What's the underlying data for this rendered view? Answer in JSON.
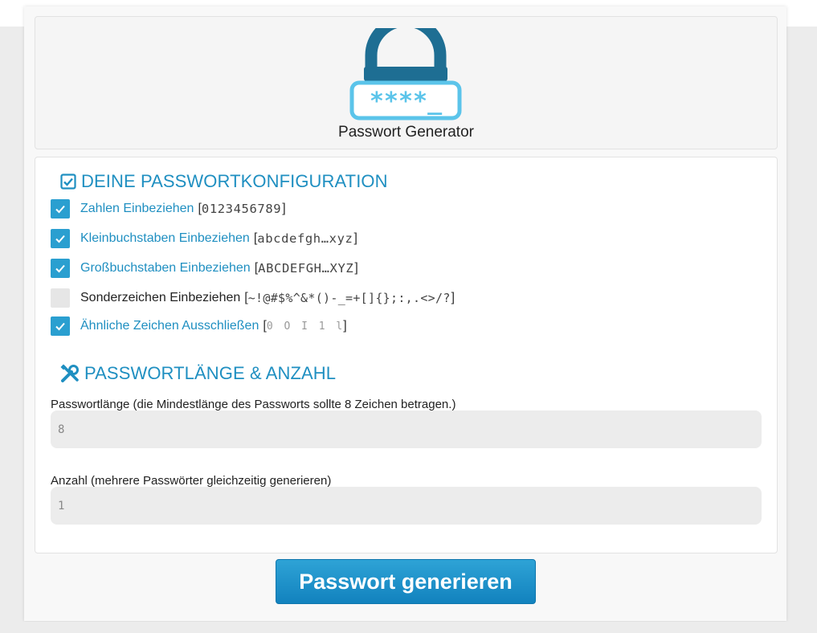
{
  "header": {
    "app_title": "Passwort Generator",
    "logo_mask": "****_"
  },
  "config": {
    "title": "DEINE PASSWORTKONFIGURATION",
    "options": [
      {
        "label": "Zahlen Einbeziehen",
        "open": "[",
        "chars": "0123456789",
        "close": "]",
        "checked": true
      },
      {
        "label": "Kleinbuchstaben Einbeziehen",
        "open": "[",
        "chars": "abcdefgh…xyz",
        "close": "]",
        "checked": true
      },
      {
        "label": "Großbuchstaben Einbeziehen",
        "open": "[",
        "chars": "ABCDEFGH…XYZ",
        "close": "]",
        "checked": true
      },
      {
        "label": "Sonderzeichen Einbeziehen",
        "open": "[",
        "chars": "~!@#$%^&*()-_=+[]{};:,.<>/?",
        "close": "]",
        "checked": false
      },
      {
        "label": "Ähnliche Zeichen Ausschließen",
        "open": "[",
        "chars": "0 O I 1 l",
        "close": "]",
        "checked": true
      }
    ]
  },
  "length_section": {
    "title": "PASSWORTLÄNGE & ANZAHL",
    "length_label": "Passwortlänge (die Mindestlänge des Passworts sollte 8 Zeichen betragen.)",
    "length_value": "8",
    "count_label": "Anzahl (mehrere Passwörter gleichzeitig generieren)",
    "count_value": "1"
  },
  "actions": {
    "generate_label": "Passwort generieren"
  },
  "colors": {
    "accent": "#1f8fc1",
    "checkbox": "#2a9fd0",
    "logo_dark": "#1e6e93",
    "logo_light": "#5bc4ea"
  },
  "icons": {
    "logo": "padlock-password-icon",
    "config": "checkbox-square-icon",
    "length": "tools-icon",
    "check": "check-icon"
  }
}
